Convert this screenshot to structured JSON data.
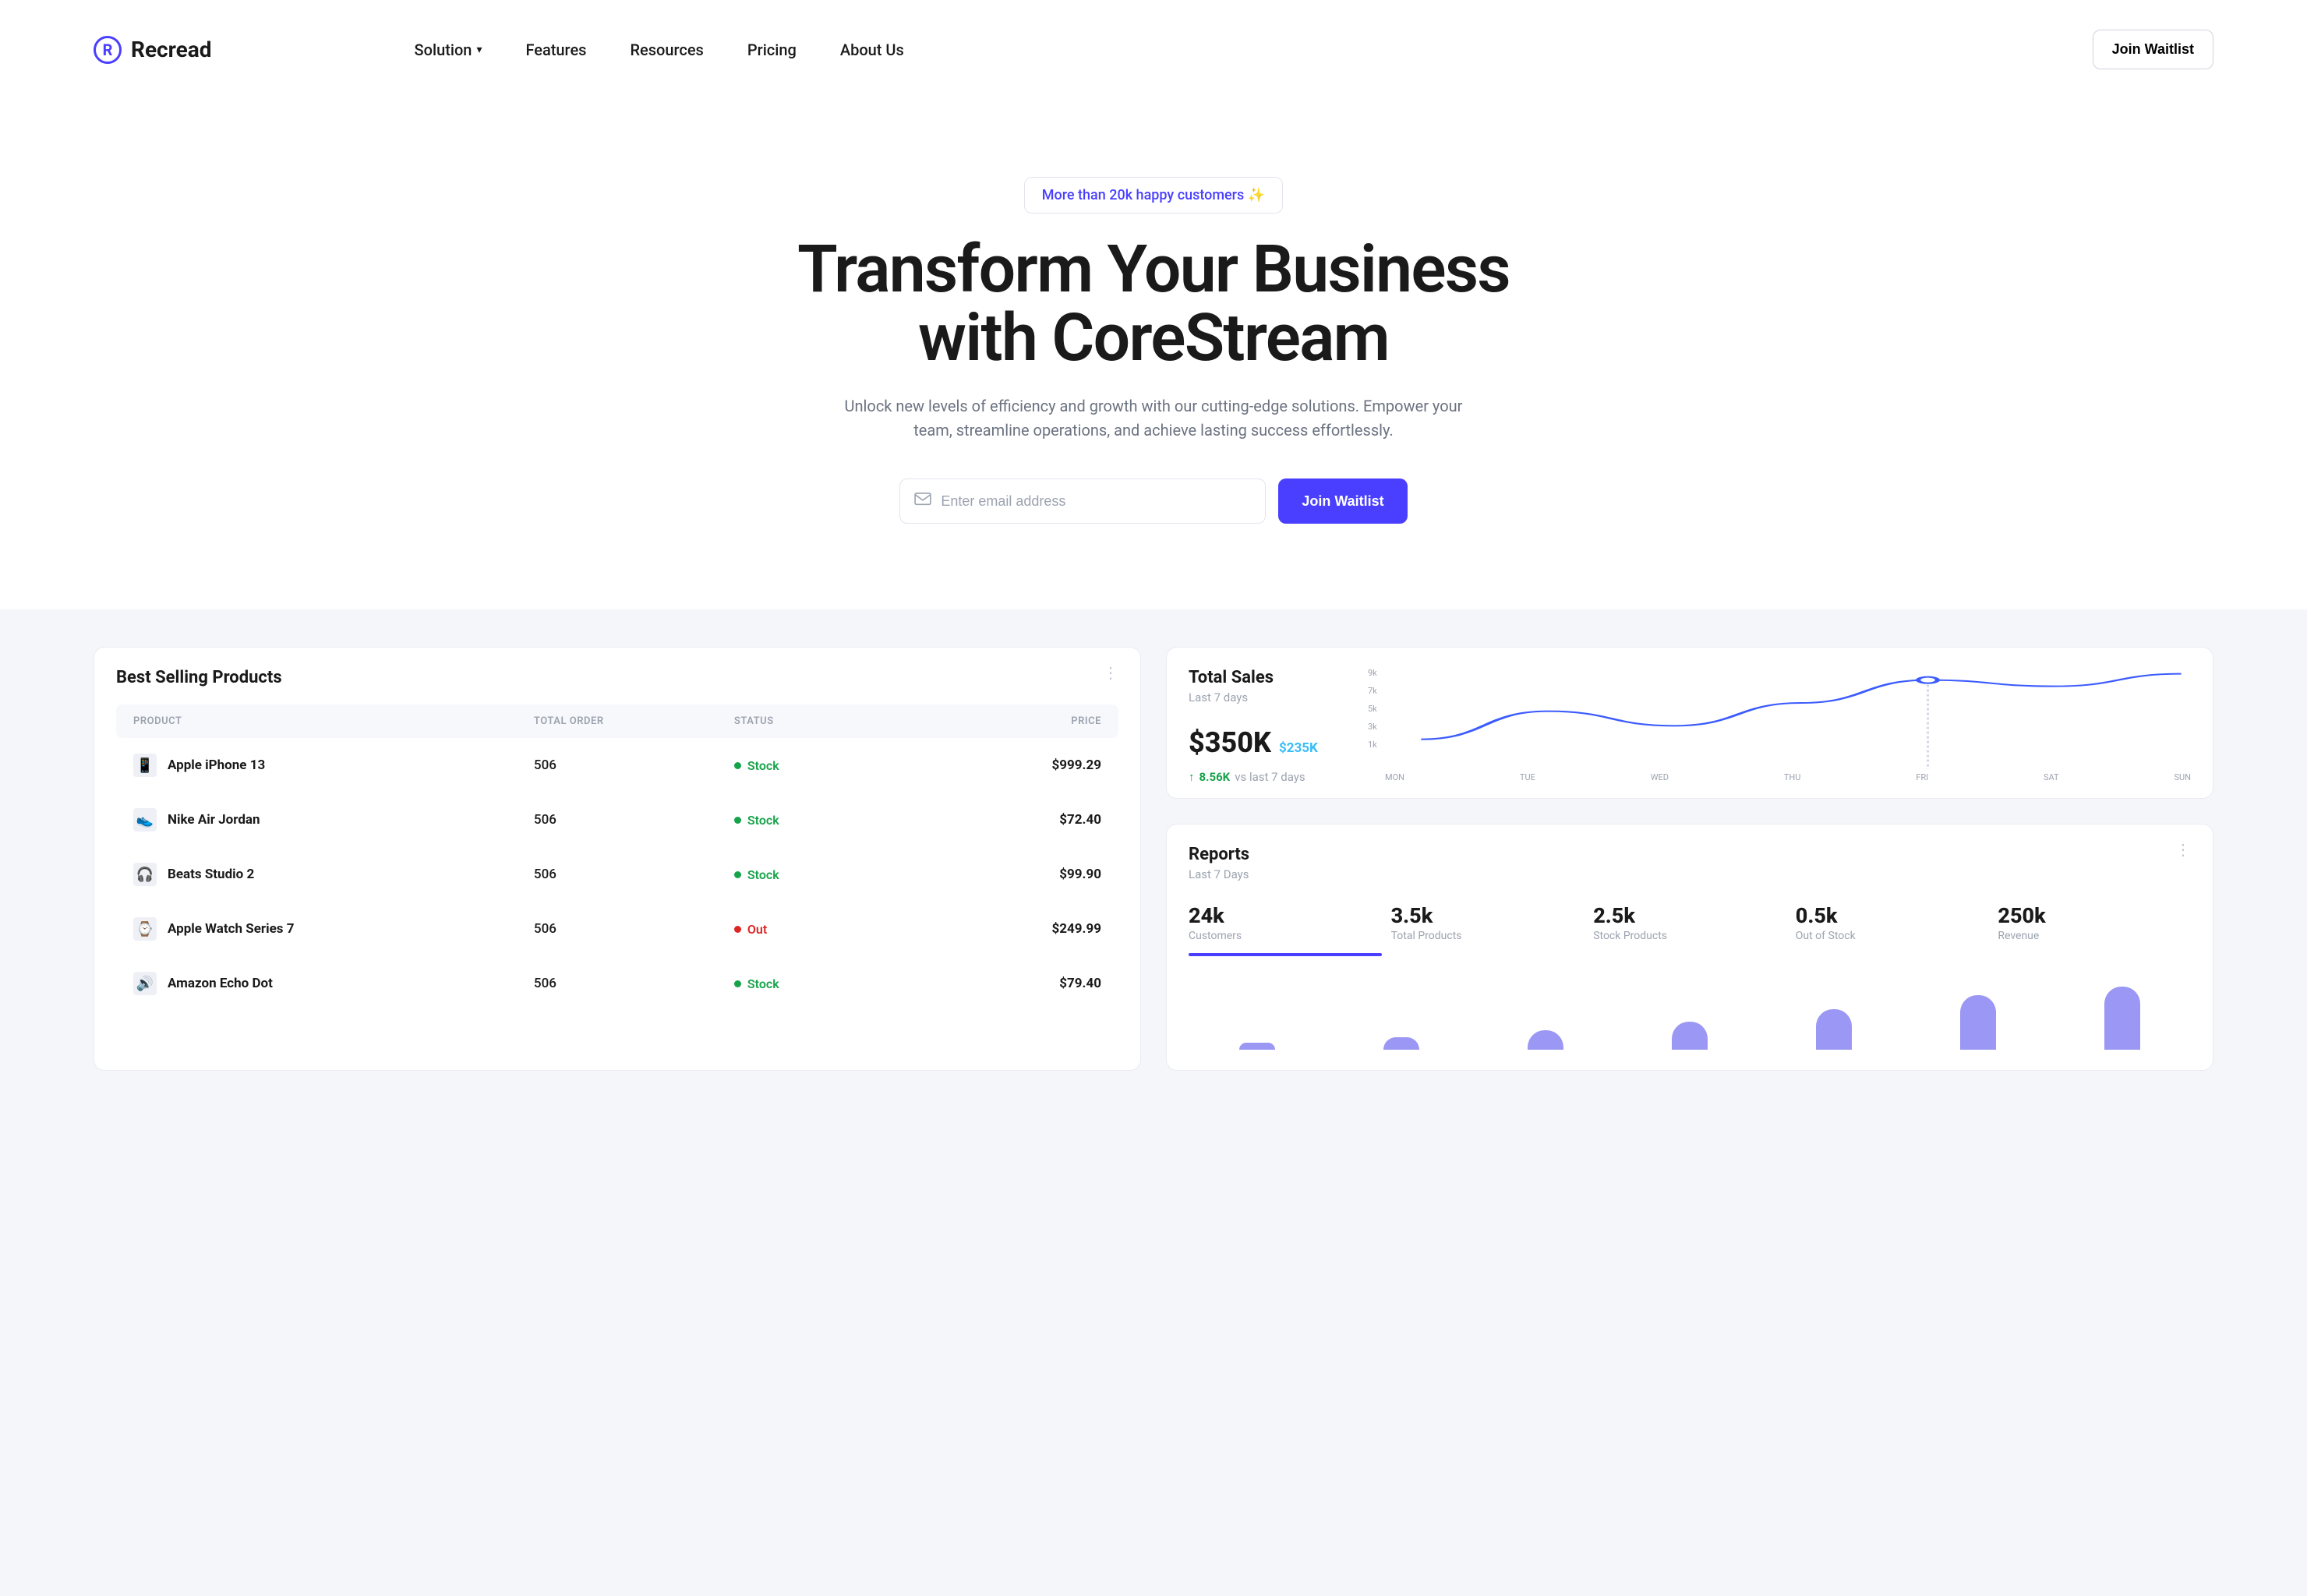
{
  "brand": {
    "mark": "R",
    "name": "Recread"
  },
  "nav": {
    "items": [
      {
        "label": "Solution",
        "has_dropdown": true
      },
      {
        "label": "Features",
        "has_dropdown": false
      },
      {
        "label": "Resources",
        "has_dropdown": false
      },
      {
        "label": "Pricing",
        "has_dropdown": false
      },
      {
        "label": "About Us",
        "has_dropdown": false
      }
    ],
    "cta": "Join Waitlist"
  },
  "hero": {
    "badge": "More than 20k happy customers ✨",
    "title_line1": "Transform Your Business",
    "title_line2": "with CoreStream",
    "subtitle": "Unlock new levels of efficiency and growth with our cutting-edge solutions. Empower your team, streamline operations, and achieve lasting success effortlessly.",
    "email_placeholder": "Enter email address",
    "waitlist_label": "Join Waitlist"
  },
  "products_card": {
    "title": "Best Selling Products",
    "columns": {
      "product": "PRODUCT",
      "total_order": "TOTAL ORDER",
      "status": "STATUS",
      "price": "PRICE"
    },
    "rows": [
      {
        "icon": "📱",
        "name": "Apple iPhone 13",
        "orders": "506",
        "status": "Stock",
        "status_color": "green",
        "price": "$999.29"
      },
      {
        "icon": "👟",
        "name": "Nike Air Jordan",
        "orders": "506",
        "status": "Stock",
        "status_color": "green",
        "price": "$72.40"
      },
      {
        "icon": "🎧",
        "name": "Beats Studio 2",
        "orders": "506",
        "status": "Stock",
        "status_color": "green",
        "price": "$99.90"
      },
      {
        "icon": "⌚",
        "name": "Apple Watch Series 7",
        "orders": "506",
        "status": "Out",
        "status_color": "red",
        "price": "$249.99"
      },
      {
        "icon": "🔊",
        "name": "Amazon Echo Dot",
        "orders": "506",
        "status": "Stock",
        "status_color": "green",
        "price": "$79.40"
      }
    ]
  },
  "sales_card": {
    "title": "Total Sales",
    "subtitle": "Last 7 days",
    "value": "$350K",
    "secondary": "$235K",
    "delta": "8.56K",
    "delta_label": "vs last 7 days"
  },
  "chart_data": {
    "type": "line",
    "title": "Total Sales",
    "ylabel": "",
    "xlabel": "",
    "ylim": [
      0,
      9000
    ],
    "y_ticks": [
      "9k",
      "7k",
      "5k",
      "3k",
      "1k"
    ],
    "categories": [
      "MON",
      "TUE",
      "WED",
      "THU",
      "FRI",
      "SAT",
      "SUN"
    ],
    "values": [
      2500,
      5200,
      3800,
      6000,
      8200,
      7600,
      8800
    ],
    "highlight_index": 4
  },
  "reports_card": {
    "title": "Reports",
    "subtitle": "Last 7 Days",
    "stats": [
      {
        "value": "24k",
        "label": "Customers",
        "active": true
      },
      {
        "value": "3.5k",
        "label": "Total Products",
        "active": false
      },
      {
        "value": "2.5k",
        "label": "Stock Products",
        "active": false
      },
      {
        "value": "0.5k",
        "label": "Out of Stock",
        "active": false
      },
      {
        "value": "250k",
        "label": "Revenue",
        "active": false
      }
    ],
    "bars": [
      10,
      18,
      28,
      40,
      58,
      78,
      90
    ]
  }
}
